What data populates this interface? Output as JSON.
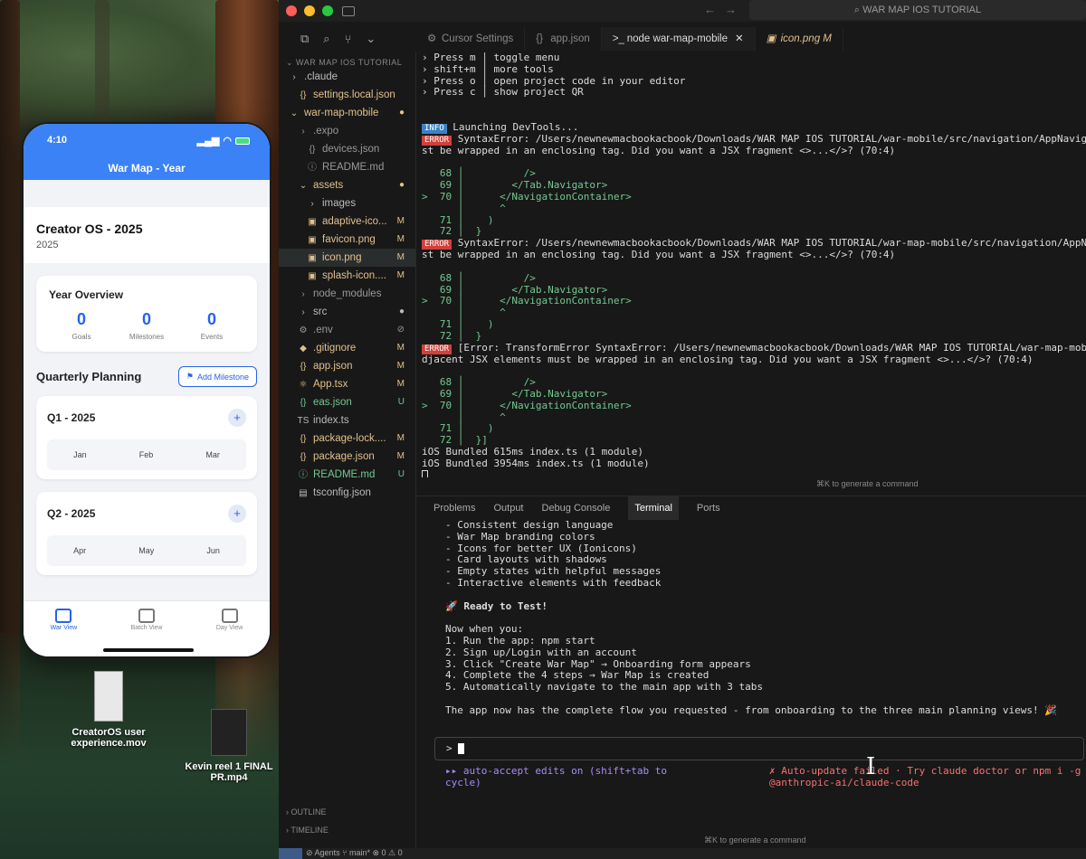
{
  "colors": {
    "phone_header": "#3b82f6",
    "accent": "#2563eb",
    "error_tag": "#d0413a",
    "info_tag": "#3b82c4"
  },
  "phone": {
    "status_time": "4:10",
    "header_title": "War Map - Year",
    "creator_title": "Creator OS  - 2025",
    "creator_year": "2025",
    "overview_title": "Year Overview",
    "stats": [
      {
        "value": "0",
        "label": "Goals"
      },
      {
        "value": "0",
        "label": "Milestones"
      },
      {
        "value": "0",
        "label": "Events"
      }
    ],
    "quarterly_title": "Quarterly Planning",
    "add_milestone": "Add Milestone",
    "quarters": [
      {
        "title": "Q1 - 2025",
        "months": [
          "Jan",
          "Feb",
          "Mar"
        ]
      },
      {
        "title": "Q2 - 2025",
        "months": [
          "Apr",
          "May",
          "Jun"
        ]
      }
    ],
    "tabs": [
      "War View",
      "Batch View",
      "Day View"
    ]
  },
  "desktop_files": [
    {
      "name": "CreatorOS user experience.mov"
    },
    {
      "name": "Kevin reel 1 FINAL PR.mp4"
    }
  ],
  "editor": {
    "search": "WAR MAP IOS TUTORIAL",
    "explorer_header": "WAR MAP IOS TUTORIAL",
    "tree": [
      {
        "icon": "›",
        "name": ".claude",
        "indent": 0,
        "badge": "",
        "cls": ""
      },
      {
        "icon": "{}",
        "name": "settings.local.json",
        "indent": 1,
        "badge": "",
        "cls": "yellow"
      },
      {
        "icon": "⌄",
        "name": "war-map-mobile",
        "indent": 0,
        "badge": "●",
        "cls": "yellow"
      },
      {
        "icon": "›",
        "name": ".expo",
        "indent": 1,
        "badge": "",
        "cls": "dim"
      },
      {
        "icon": "{}",
        "name": "devices.json",
        "indent": 2,
        "badge": "",
        "cls": "dim"
      },
      {
        "icon": "ⓘ",
        "name": "README.md",
        "indent": 2,
        "badge": "",
        "cls": "dim"
      },
      {
        "icon": "⌄",
        "name": "assets",
        "indent": 1,
        "badge": "●",
        "cls": "yellow"
      },
      {
        "icon": "›",
        "name": "images",
        "indent": 2,
        "badge": "",
        "cls": ""
      },
      {
        "icon": "▣",
        "name": "adaptive-ico...",
        "indent": 2,
        "badge": "M",
        "cls": "yellow"
      },
      {
        "icon": "▣",
        "name": "favicon.png",
        "indent": 2,
        "badge": "M",
        "cls": "yellow"
      },
      {
        "icon": "▣",
        "name": "icon.png",
        "indent": 2,
        "badge": "M",
        "cls": "yellow",
        "sel": true
      },
      {
        "icon": "▣",
        "name": "splash-icon....",
        "indent": 2,
        "badge": "M",
        "cls": "yellow"
      },
      {
        "icon": "›",
        "name": "node_modules",
        "indent": 1,
        "badge": "",
        "cls": "dim"
      },
      {
        "icon": "›",
        "name": "src",
        "indent": 1,
        "badge": "●",
        "cls": ""
      },
      {
        "icon": "⚙",
        "name": ".env",
        "indent": 1,
        "badge": "⊘",
        "cls": "dim"
      },
      {
        "icon": "◆",
        "name": ".gitignore",
        "indent": 1,
        "badge": "M",
        "cls": "yellow"
      },
      {
        "icon": "{}",
        "name": "app.json",
        "indent": 1,
        "badge": "M",
        "cls": "yellow"
      },
      {
        "icon": "⚛",
        "name": "App.tsx",
        "indent": 1,
        "badge": "M",
        "cls": "yellow"
      },
      {
        "icon": "{}",
        "name": "eas.json",
        "indent": 1,
        "badge": "U",
        "cls": "green"
      },
      {
        "icon": "TS",
        "name": "index.ts",
        "indent": 1,
        "badge": "",
        "cls": ""
      },
      {
        "icon": "{}",
        "name": "package-lock....",
        "indent": 1,
        "badge": "M",
        "cls": "yellow"
      },
      {
        "icon": "{}",
        "name": "package.json",
        "indent": 1,
        "badge": "M",
        "cls": "yellow"
      },
      {
        "icon": "ⓘ",
        "name": "README.md",
        "indent": 1,
        "badge": "U",
        "cls": "green"
      },
      {
        "icon": "▤",
        "name": "tsconfig.json",
        "indent": 1,
        "badge": "",
        "cls": ""
      }
    ],
    "outline": "OUTLINE",
    "timeline": "TIMELINE",
    "tabs": [
      {
        "icon": "⚙",
        "label": "Cursor Settings"
      },
      {
        "icon": "{}",
        "label": "app.json"
      },
      {
        "icon": ">_",
        "label": "node war-map-mobile"
      },
      {
        "icon": "▣",
        "label": "icon.png M"
      }
    ],
    "hint_cmd": "⌘K to generate a command",
    "panel_tabs": [
      "Problems",
      "Output",
      "Debug Console",
      "Terminal",
      "Ports"
    ],
    "prompt_symbol": ">",
    "auto_accept": "▸▸ auto-accept edits on (shift+tab to\ncycle)",
    "auto_update": "✗ Auto-update failed · Try claude doctor or npm i -g\n@anthropic-ai/claude-code",
    "status": "⊘ Agents  ⑂ main*  ⊗ 0 ⚠ 0"
  },
  "terminal_top": {
    "menu": [
      "› Press m │ toggle menu",
      "› shift+m │ more tools",
      "› Press o │ open project code in your editor",
      "› Press c │ show project QR"
    ],
    "info_tag": "INFO",
    "info_text": " Launching DevTools...",
    "error_tag": "ERROR",
    "error1_a": " SyntaxError: /Users/newnewmacbookacbook/Downloads/WAR MAP IOS TUTORIAL/war-mobile/src/navigation/AppNavigator.tsx: Adjacent JSX elements mu",
    "error1_b": "st be wrapped in an enclosing tag. Did you want a JSX fragment <>...</>? (70:4)",
    "code1": "   68 │          />\n   69 │        </Tab.Navigator>\n>  70 │      </NavigationContainer>\n      │      ^\n   71 │    )\n   72 │  }",
    "error2_a": " SyntaxError: /Users/newnewmacbookacbook/Downloads/WAR MAP IOS TUTORIAL/war-map-mobile/src/navigation/AppNavigator.tsx: Adjacent JSX elements mu",
    "error2_b": "st be wrapped in an enclosing tag. Did you want a JSX fragment <>...</>? (70:4)",
    "code2": "   68 │          />\n   69 │        </Tab.Navigator>\n>  70 │      </NavigationContainer>\n      │      ^\n   71 │    )\n   72 │  }",
    "error3_a": " [Error: TransformError SyntaxError: /Users/newnewmacbookacbook/Downloads/WAR MAP IOS TUTORIAL/war-map-mobile/src/navigation/AppNavigator.tsx: A",
    "error3_b": "djacent JSX elements must be wrapped in an enclosing tag. Did you want a JSX fragment <>...</>? (70:4)",
    "code3": "   68 │          />\n   69 │        </Tab.Navigator>\n>  70 │      </NavigationContainer>\n      │      ^\n   71 │    )\n   72 │  }]",
    "bundled1": "iOS Bundled 615ms index.ts (1 module)",
    "bundled2": "iOS Bundled 3954ms index.ts (1 module)"
  },
  "terminal_bottom": {
    "bullets": [
      "- Consistent design language",
      "- War Map branding colors",
      "- Icons for better UX (Ionicons)",
      "- Card layouts with shadows",
      "- Empty states with helpful messages",
      "- Interactive elements with feedback"
    ],
    "ready": "🚀 Ready to Test!",
    "now_when": "Now when you:",
    "steps": [
      "1. Run the app: npm start",
      "2. Sign up/Login with an account",
      "3. Click \"Create War Map\" → Onboarding form appears",
      "4. Complete the 4 steps → War Map is created",
      "5. Automatically navigate to the main app with 3 tabs"
    ],
    "summary": "The app now has the complete flow you requested - from onboarding to the three main planning views! 🎉"
  }
}
